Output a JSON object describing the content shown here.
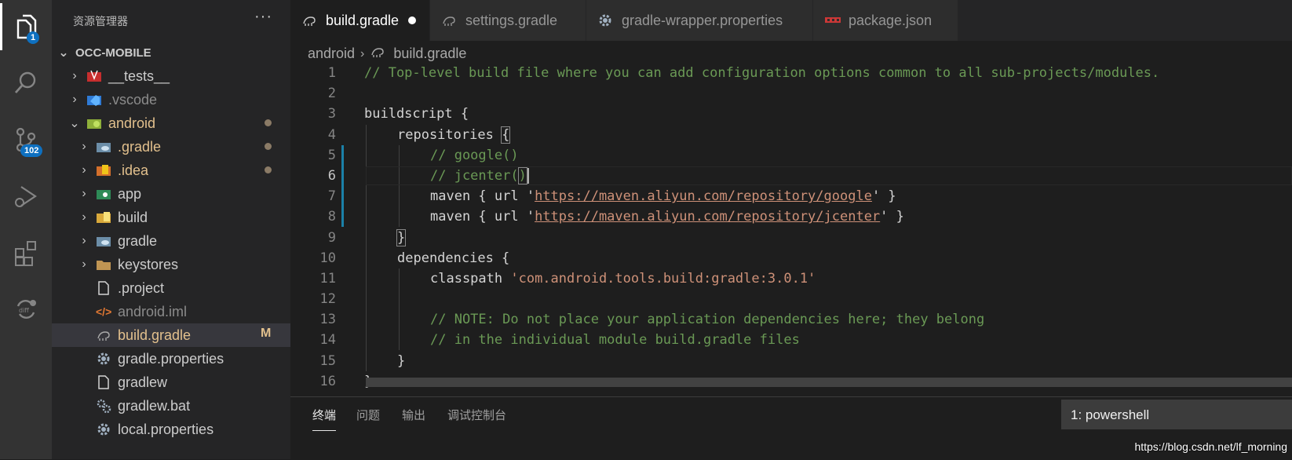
{
  "activity_bar": {
    "explorer_badge": "1",
    "scm_badge": "102"
  },
  "sidebar": {
    "title": "资源管理器",
    "more": "···",
    "project": "OCC-MOBILE",
    "items": [
      {
        "label": "__tests__",
        "icon": "tests-folder-icon"
      },
      {
        "label": ".vscode",
        "icon": "vscode-folder-icon"
      },
      {
        "label": "android",
        "icon": "android-folder-icon"
      },
      {
        "label": ".gradle",
        "icon": "gradle-folder-icon"
      },
      {
        "label": ".idea",
        "icon": "idea-folder-icon"
      },
      {
        "label": "app",
        "icon": "app-folder-icon"
      },
      {
        "label": "build",
        "icon": "build-folder-icon"
      },
      {
        "label": "gradle",
        "icon": "gradle-folder-icon"
      },
      {
        "label": "keystores",
        "icon": "folder-icon"
      },
      {
        "label": ".project",
        "icon": "file-icon"
      },
      {
        "label": "android.iml",
        "icon": "xml-icon"
      },
      {
        "label": "build.gradle",
        "icon": "gradle-file-icon",
        "status": "M"
      },
      {
        "label": "gradle.properties",
        "icon": "gear-icon"
      },
      {
        "label": "gradlew",
        "icon": "file-icon"
      },
      {
        "label": "gradlew.bat",
        "icon": "gears-icon"
      },
      {
        "label": "local.properties",
        "icon": "gear-icon"
      }
    ]
  },
  "tabs": [
    {
      "label": "build.gradle",
      "icon": "gradle-file-icon",
      "active": true,
      "modified": true
    },
    {
      "label": "settings.gradle",
      "icon": "gradle-file-icon"
    },
    {
      "label": "gradle-wrapper.properties",
      "icon": "gear-icon"
    },
    {
      "label": "package.json",
      "icon": "npm-icon"
    }
  ],
  "breadcrumb": {
    "folder": "android",
    "sep": "›",
    "file": "build.gradle"
  },
  "code": {
    "line_numbers": [
      "1",
      "2",
      "3",
      "4",
      "5",
      "6",
      "7",
      "8",
      "9",
      "10",
      "11",
      "12",
      "13",
      "14",
      "15",
      "16"
    ],
    "l1": "// Top-level build file where you can add configuration options common to all sub-projects/modules.",
    "l3": "buildscript {",
    "l4a": "repositories ",
    "l4b": "{",
    "l5": "// google()",
    "l6a": "// jcenter(",
    "l6b": ")",
    "l7a": "maven { url '",
    "l7url": "https://maven.aliyun.com/repository/google",
    "l7b": "' }",
    "l8a": "maven { url '",
    "l8url": "https://maven.aliyun.com/repository/jcenter",
    "l8b": "' }",
    "l9": "}",
    "l10": "dependencies {",
    "l11a": "classpath ",
    "l11b": "'com.android.tools.build:gradle:3.0.1'",
    "l13": "// NOTE: Do not place your application dependencies here; they belong",
    "l14": "// in the individual module build.gradle files",
    "l15": "}",
    "l16": "}"
  },
  "panel": {
    "tabs": [
      "终端",
      "问题",
      "输出",
      "调试控制台"
    ],
    "terminal_select": "1: powershell"
  },
  "watermark": "https://blog.csdn.net/lf_morning",
  "colors": {
    "comment": "#6a9955",
    "string": "#ce9178",
    "badge": "#0e70c0"
  }
}
